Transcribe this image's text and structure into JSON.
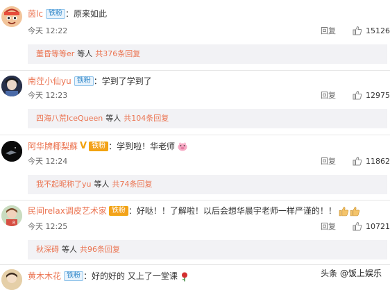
{
  "comments": [
    {
      "user": "茵lc",
      "fan_badge": "铁粉",
      "text": "：原来如此",
      "time": "今天 12:22",
      "reply_label": "回复",
      "likes": "15126",
      "reply_summary": {
        "name": "董昏等等er",
        "mid": "等人",
        "link": "共376条回复"
      }
    },
    {
      "user": "南茳小仙yu",
      "fan_badge": "铁粉",
      "text": "：学到了学到了",
      "time": "今天 12:23",
      "reply_label": "回复",
      "likes": "12975",
      "reply_summary": {
        "name": "四海八荒IceQueen",
        "mid": "等人",
        "link": "共104条回复"
      }
    },
    {
      "user": "阿华牌椰梨蘇",
      "vip_mark": "V",
      "fan_badge": "铁粉",
      "text": "：学到啦！华老师",
      "time": "今天 12:24",
      "reply_label": "回复",
      "likes": "11862",
      "reply_summary": {
        "name": "我不起昵称了yu",
        "mid": "等人",
        "link": "共74条回复"
      }
    },
    {
      "user": "民间relax调皮艺术家",
      "fan_badge": "铁粉",
      "text": "：好哒！！了解啦！以后会想华晨宇老师一样严谨的！！",
      "time": "今天 12:25",
      "reply_label": "回复",
      "likes": "10721",
      "reply_summary": {
        "name": "秋深碍",
        "mid": "等人",
        "link": "共96条回复"
      }
    },
    {
      "user": "黄木木花",
      "fan_badge": "铁粉",
      "text": "：好的好的 又上了一堂课"
    }
  ],
  "watermark": "头条 @饭上娱乐",
  "colors": {
    "username": "#eb7350",
    "fan_badge": "#2f86c8",
    "gold_badge": "#f3a21b",
    "reply_box_bg": "#f2f2f5"
  },
  "icons": [
    "like-thumb-icon",
    "pig-emoji-icon",
    "thumbs-up-emoji-icon",
    "rose-emoji-icon"
  ]
}
